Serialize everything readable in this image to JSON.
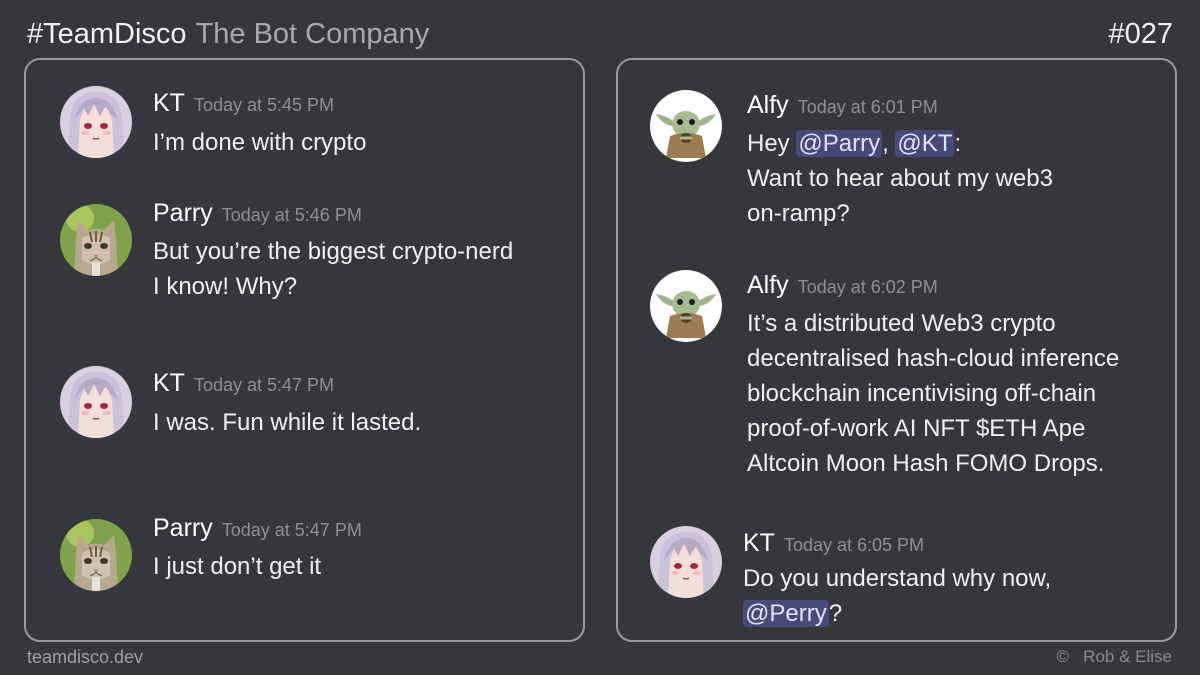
{
  "header": {
    "hashtag": "#TeamDisco",
    "company": "The Bot Company",
    "episode": "#027"
  },
  "left_panel": {
    "messages": [
      {
        "author": "KT",
        "time": "Today at 5:45 PM",
        "avatar": "anime-girl-avatar",
        "text": "I’m done with crypto"
      },
      {
        "author": "Parry",
        "time": "Today at 5:46 PM",
        "avatar": "cat-avatar",
        "text": "But you’re the biggest crypto-nerd\nI know!  Why?"
      },
      {
        "author": "KT",
        "time": "Today at 5:47 PM",
        "avatar": "anime-girl-avatar",
        "text": "I was.  Fun while it lasted."
      },
      {
        "author": "Parry",
        "time": "Today at 5:47 PM",
        "avatar": "cat-avatar",
        "text": "I just don’t get it"
      }
    ]
  },
  "right_panel": {
    "messages": [
      {
        "author": "Alfy",
        "time": "Today at 6:01 PM",
        "avatar": "baby-yoda-avatar",
        "text_pre": "Hey ",
        "mention1": "@Parry",
        "text_mid": ", ",
        "mention2": "@KT",
        "text_post": ":\nWant to hear about my web3\non-ramp?"
      },
      {
        "author": "Alfy",
        "time": "Today at 6:02 PM",
        "avatar": "baby-yoda-avatar",
        "text": "It’s a distributed Web3 crypto\ndecentralised hash-cloud inference\nblockchain incentivising off-chain\nproof-of-work AI NFT $ETH Ape\nAltcoin Moon Hash FOMO Drops."
      },
      {
        "author": "KT",
        "time": "Today at 6:05 PM",
        "avatar": "anime-girl-avatar",
        "text_pre": "Do you understand why now,\n",
        "mention": "@Perry",
        "text_post": "?"
      }
    ]
  },
  "footer": {
    "site": "teamdisco.dev",
    "credit": "©   Rob & Elise"
  },
  "colors": {
    "background": "#36373c",
    "panel_border": "#9a9a9e",
    "mention_bg": "#454a78",
    "timestamp": "#8e8f94"
  }
}
